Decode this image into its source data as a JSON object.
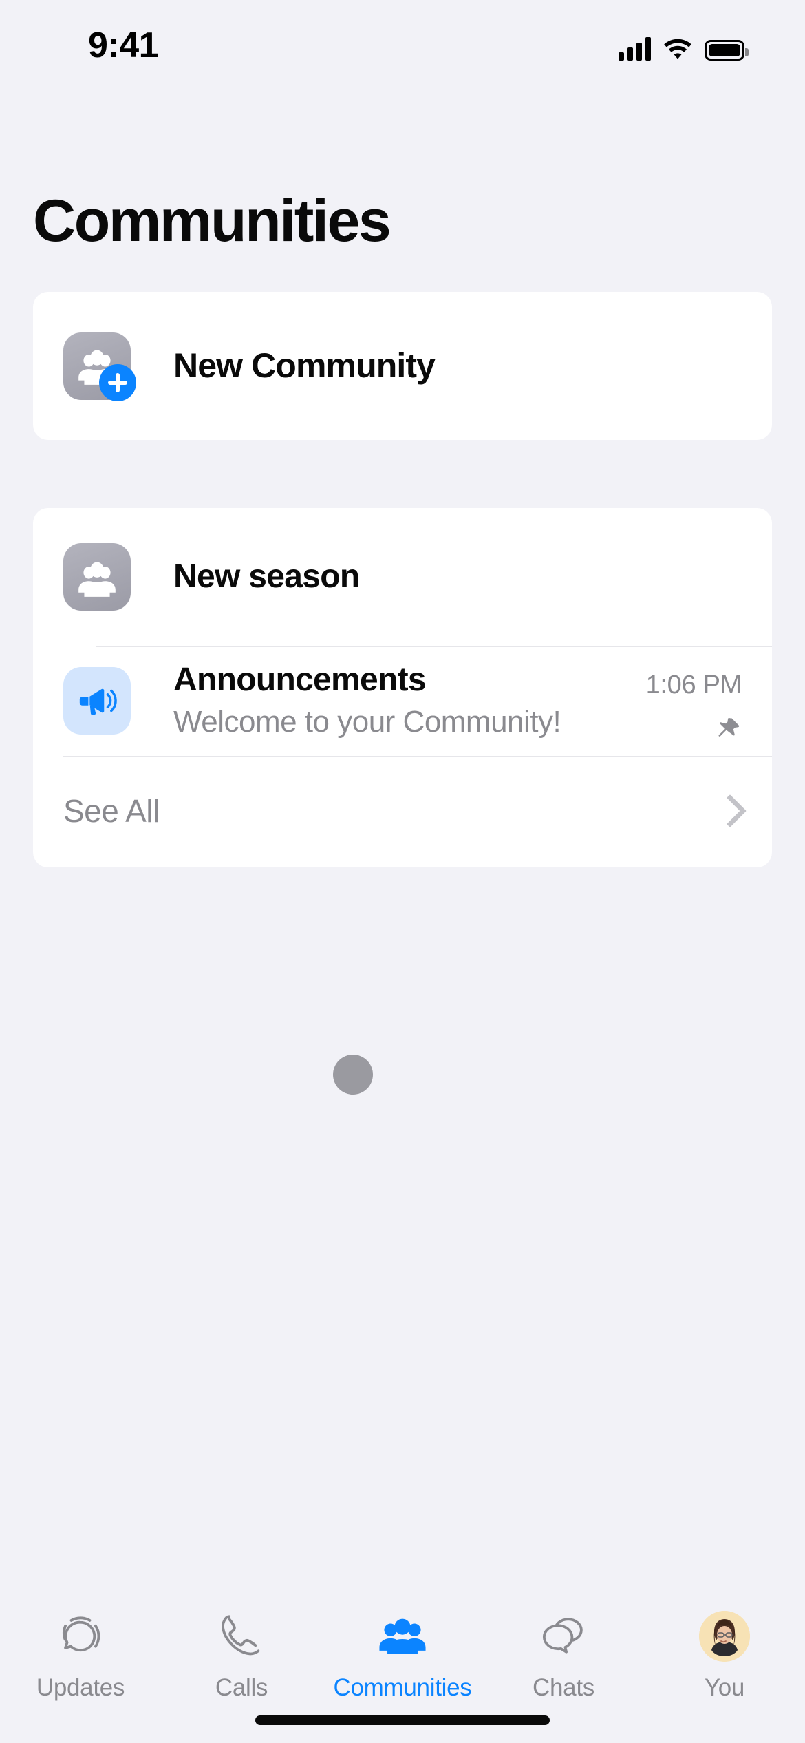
{
  "status_bar": {
    "time": "9:41",
    "cellular_icon": "cellular-bars-icon",
    "wifi_icon": "wifi-icon",
    "battery_icon": "battery-full-icon"
  },
  "header": {
    "title": "Communities"
  },
  "new_community": {
    "label": "New Community",
    "icon": "group-add-icon",
    "badge_icon": "plus-badge-icon"
  },
  "community": {
    "name": "New season",
    "icon": "group-icon",
    "rows": [
      {
        "title": "Announcements",
        "subtitle": "Welcome to your Community!",
        "time": "1:06 PM",
        "icon": "megaphone-icon",
        "pin_icon": "pin-icon"
      }
    ],
    "see_all": {
      "label": "See All",
      "chevron_icon": "chevron-right-icon"
    }
  },
  "loading": {
    "indicator": "loading-dot"
  },
  "tabbar": {
    "items": [
      {
        "label": "Updates",
        "icon": "status-updates-icon",
        "active": false
      },
      {
        "label": "Calls",
        "icon": "phone-icon",
        "active": false
      },
      {
        "label": "Communities",
        "icon": "people-group-icon",
        "active": true
      },
      {
        "label": "Chats",
        "icon": "chat-bubbles-icon",
        "active": false
      },
      {
        "label": "You",
        "icon": "profile-avatar-icon",
        "active": false
      }
    ]
  },
  "colors": {
    "background": "#f2f2f7",
    "card": "#ffffff",
    "accent": "#0b84ff",
    "secondary_text": "#8a8a8f",
    "primary_text": "#0a0a0a"
  },
  "home_indicator": "home-indicator"
}
